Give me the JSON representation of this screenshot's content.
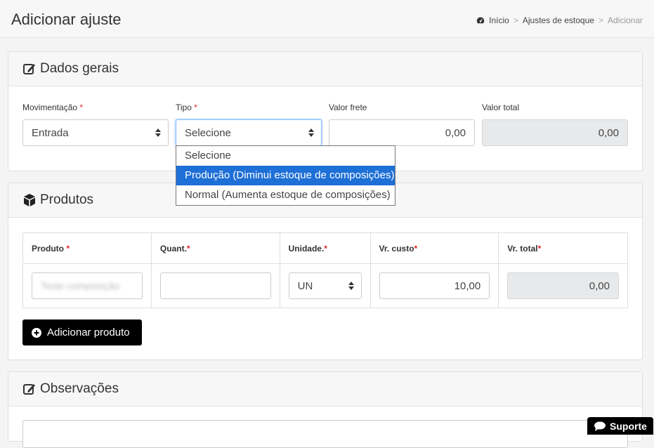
{
  "header": {
    "title": "Adicionar ajuste",
    "breadcrumb": {
      "home": "Início",
      "parent": "Ajustes de estoque",
      "current": "Adicionar"
    }
  },
  "dados_gerais": {
    "title": "Dados gerais",
    "movimentacao": {
      "label": "Movimentação",
      "value": "Entrada"
    },
    "tipo": {
      "label": "Tipo",
      "value": "Selecione",
      "options": [
        "Selecione",
        "Produção (Diminui estoque de composições)",
        "Normal (Aumenta estoque de composições)"
      ],
      "highlighted_index": 1
    },
    "valor_frete": {
      "label": "Valor frete",
      "value": "0,00"
    },
    "valor_total": {
      "label": "Valor total",
      "value": "0,00"
    }
  },
  "produtos": {
    "title": "Produtos",
    "columns": [
      "Produto",
      "Quant.",
      "Unidade.",
      "Vr. custo",
      "Vr. total"
    ],
    "row": {
      "produto": "Teste composição",
      "quant": "",
      "unidade": "UN",
      "vr_custo": "10,00",
      "vr_total": "0,00"
    },
    "add_button": "Adicionar produto"
  },
  "observacoes": {
    "title": "Observações"
  },
  "support": {
    "label": "Suporte"
  },
  "colors": {
    "accent": "#1e6fd6",
    "required": "#e02424",
    "button": "#000000"
  }
}
